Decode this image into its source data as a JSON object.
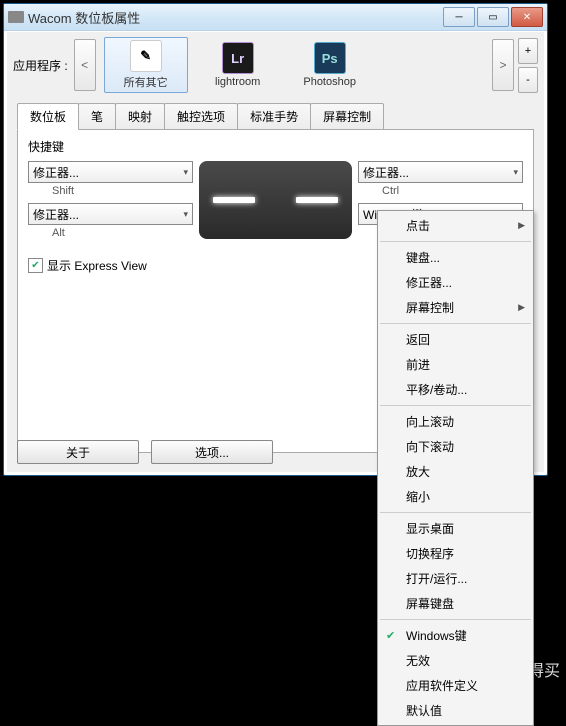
{
  "window": {
    "title": "Wacom 数位板属性"
  },
  "app": {
    "label": "应用程序 :",
    "prev": "<",
    "next": ">",
    "plus": "+",
    "minus": "-",
    "items": [
      {
        "name": "所有其它",
        "icon": "other",
        "glyph": "✎",
        "selected": true
      },
      {
        "name": "lightroom",
        "icon": "lr",
        "glyph": "Lr",
        "selected": false
      },
      {
        "name": "Photoshop",
        "icon": "ps",
        "glyph": "Ps",
        "selected": false
      }
    ]
  },
  "tabs": [
    "数位板",
    "笔",
    "映射",
    "触控选项",
    "标准手势",
    "屏幕控制"
  ],
  "activeTab": 0,
  "section": "快捷键",
  "combos": {
    "tl": {
      "value": "修正器...",
      "sub": "Shift"
    },
    "bl": {
      "value": "修正器...",
      "sub": "Alt"
    },
    "tr": {
      "value": "修正器...",
      "sub": "Ctrl"
    },
    "br": {
      "value": "Windows键",
      "sub": ""
    }
  },
  "checkbox": {
    "label": "显示 Express View",
    "checked": true
  },
  "buttons": {
    "about": "关于",
    "options": "选项..."
  },
  "menu": {
    "groups": [
      [
        {
          "label": "点击",
          "sub": true
        }
      ],
      [
        {
          "label": "键盘..."
        },
        {
          "label": "修正器..."
        },
        {
          "label": "屏幕控制",
          "sub": true
        }
      ],
      [
        {
          "label": "返回"
        },
        {
          "label": "前进"
        },
        {
          "label": "平移/卷动..."
        }
      ],
      [
        {
          "label": "向上滚动"
        },
        {
          "label": "向下滚动"
        },
        {
          "label": "放大"
        },
        {
          "label": "缩小"
        }
      ],
      [
        {
          "label": "显示桌面"
        },
        {
          "label": "切换程序"
        },
        {
          "label": "打开/运行..."
        },
        {
          "label": "屏幕键盘"
        }
      ],
      [
        {
          "label": "Windows键",
          "checked": true
        },
        {
          "label": "无效"
        },
        {
          "label": "应用软件定义"
        },
        {
          "label": "默认值"
        }
      ]
    ]
  },
  "watermark": "什么值得买"
}
